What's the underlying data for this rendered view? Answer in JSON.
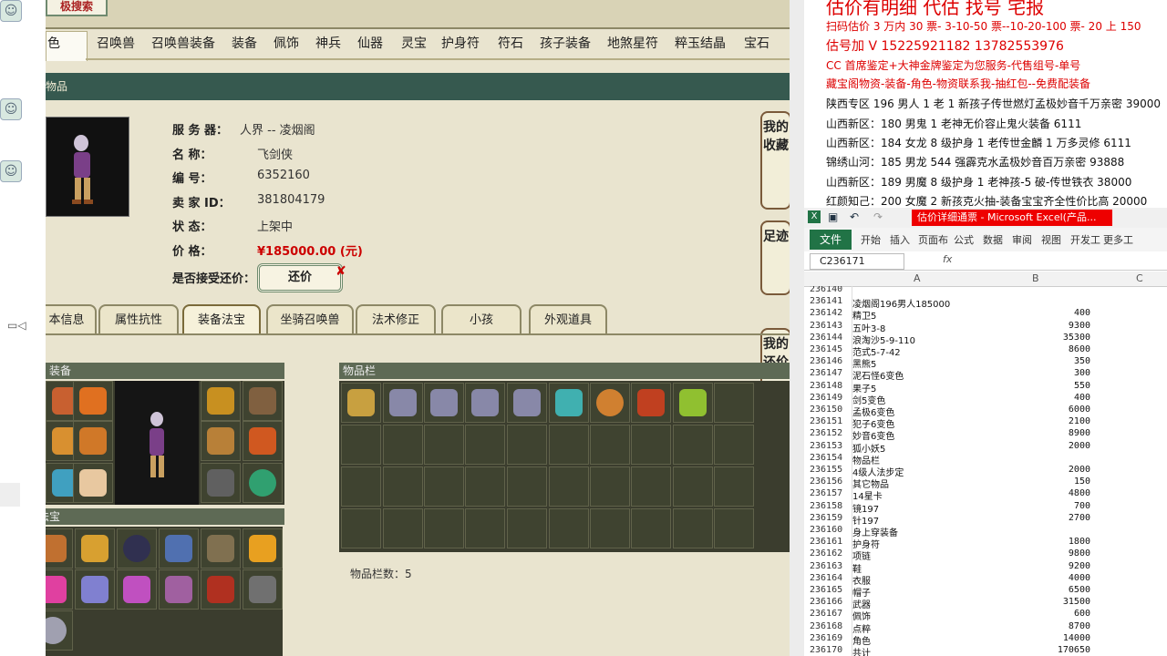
{
  "game": {
    "logo_tab": "极搜索",
    "categories": [
      "色",
      "召唤兽",
      "召唤兽装备",
      "装备",
      "佩饰",
      "神兵",
      "仙器",
      "灵宝",
      "护身符",
      "符石",
      "孩子装备",
      "地煞星符",
      "粹玉结晶",
      "宝石"
    ],
    "section_title": "物品",
    "fields": [
      {
        "label": "服 务 器：",
        "value": "人界 -- 凌烟阁"
      },
      {
        "label": "名        称：",
        "value": "飞剑侠"
      },
      {
        "label": "编        号：",
        "value": "6352160"
      },
      {
        "label": "卖  家  ID：",
        "value": "381804179"
      },
      {
        "label": "状        态：",
        "value": "上架中"
      },
      {
        "label": "价        格：",
        "value": "¥185000.00 (元)"
      }
    ],
    "accept_counter_label": "是否接受还价：",
    "counter_button": "还价",
    "side_buttons": [
      {
        "label": "我的收藏"
      },
      {
        "label": "足迹"
      },
      {
        "label": "我的还价"
      }
    ],
    "subtabs": [
      "本信息",
      "属性抗性",
      "装备法宝",
      "坐骑召唤兽",
      "法术修正",
      "小孩",
      "外观道具"
    ],
    "equip_header": "装备",
    "fabao_header": "法宝",
    "items_header": "物品栏",
    "item_count": "物品栏数：5",
    "colors": {
      "teal_header": "#36594f",
      "bg": "#e9e4cf",
      "price": "#cc0000"
    }
  },
  "ad": {
    "lines": [
      {
        "text": "估价有明细 代估 找号 宅报",
        "color": "red"
      },
      {
        "text": "扫码估价 3 万内 30 票- 3-10-50 票--10-20-100 票- 20 上 150",
        "color": "red"
      },
      {
        "text": "估号加 V 15225921182   13782553976",
        "color": "red"
      },
      {
        "text": "CC 首席鉴定+大神金牌鉴定为您服务-代售组号-单号",
        "color": "red"
      },
      {
        "text": "藏宝阁物资-装备-角色-物资联系我-抽红包--免费配装备",
        "color": "red"
      },
      {
        "text": "陕西专区 196 男人 1 老 1 新孩子传世燃灯孟极妙音千万亲密 39000",
        "color": "black"
      },
      {
        "text": "山西新区：180 男鬼 1 老神无价容止鬼火装备 6111",
        "color": "black"
      },
      {
        "text": "山西新区：184 女龙 8 级护身 1 老传世金麟 1 万多灵修 6111",
        "color": "black"
      },
      {
        "text": "锦绣山河：185 男龙 544 强霹克水孟极妙音百万亲密 93888",
        "color": "black"
      },
      {
        "text": "山西新区：189 男魔 8 级护身 1 老神孩-5 破-传世铁衣 38000",
        "color": "black"
      },
      {
        "text": "红颜知己：200 女魔 2 新孩克火抽-装备宝宝齐全性价比高 20000",
        "color": "black"
      }
    ]
  },
  "excel": {
    "title": "估价详细通票 - Microsoft Excel(产品...",
    "ribbon_file": "文件",
    "ribbon_tabs": [
      "开始",
      "插入",
      "页面布",
      "公式",
      "数据",
      "审阅",
      "视图",
      "开发工",
      "更多工"
    ],
    "name_box": "C236171",
    "fx": "fx",
    "columns": [
      "A",
      "B",
      "C"
    ],
    "rows": [
      {
        "n": "236140",
        "a": "",
        "b": ""
      },
      {
        "n": "236141",
        "a": "凌烟阁196男人185000",
        "b": ""
      },
      {
        "n": "236142",
        "a": "精卫5",
        "b": "400"
      },
      {
        "n": "236143",
        "a": "五叶3-8",
        "b": "9300"
      },
      {
        "n": "236144",
        "a": "浪淘沙5-9-110",
        "b": "35300"
      },
      {
        "n": "236145",
        "a": "范式5-7-42",
        "b": "8600"
      },
      {
        "n": "236146",
        "a": "黑熊5",
        "b": "350"
      },
      {
        "n": "236147",
        "a": "泥石怪6变色",
        "b": "300"
      },
      {
        "n": "236148",
        "a": "果子5",
        "b": "550"
      },
      {
        "n": "236149",
        "a": "剑5变色",
        "b": "400"
      },
      {
        "n": "236150",
        "a": "孟极6变色",
        "b": "6000"
      },
      {
        "n": "236151",
        "a": "犯子6变色",
        "b": "2100"
      },
      {
        "n": "236152",
        "a": "妙音6变色",
        "b": "8900"
      },
      {
        "n": "236153",
        "a": "狐小妖5",
        "b": "2000"
      },
      {
        "n": "236154",
        "a": "物品栏",
        "b": ""
      },
      {
        "n": "236155",
        "a": "4级人法步定",
        "b": "2000"
      },
      {
        "n": "236156",
        "a": "其它物品",
        "b": "150"
      },
      {
        "n": "236157",
        "a": "14星卡",
        "b": "4800"
      },
      {
        "n": "236158",
        "a": "镜197",
        "b": "700"
      },
      {
        "n": "236159",
        "a": "针197",
        "b": "2700"
      },
      {
        "n": "236160",
        "a": "身上穿装备",
        "b": ""
      },
      {
        "n": "236161",
        "a": "护身符",
        "b": "1800"
      },
      {
        "n": "236162",
        "a": "项链",
        "b": "9800"
      },
      {
        "n": "236163",
        "a": "鞋",
        "b": "9200"
      },
      {
        "n": "236164",
        "a": "衣服",
        "b": "4000"
      },
      {
        "n": "236165",
        "a": "帽子",
        "b": "6500"
      },
      {
        "n": "236166",
        "a": "武器",
        "b": "31500"
      },
      {
        "n": "236167",
        "a": "佩饰",
        "b": "600"
      },
      {
        "n": "236168",
        "a": "点粹",
        "b": "8700"
      },
      {
        "n": "236169",
        "a": "角色",
        "b": "14000"
      },
      {
        "n": "236170",
        "a": "共计",
        "b": "170650"
      }
    ]
  }
}
